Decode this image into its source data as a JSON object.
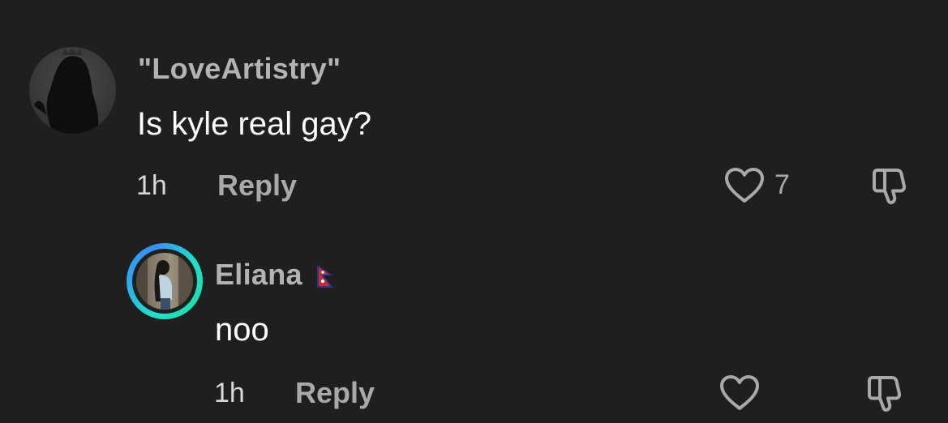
{
  "comments": [
    {
      "username": "\"LoveArtistry\"",
      "text": "Is kyle real gay?",
      "time": "1h",
      "reply_label": "Reply",
      "likes": "7"
    }
  ],
  "reply": {
    "username": "Eliana",
    "text": "noo",
    "time": "1h",
    "reply_label": "Reply"
  },
  "icons": {
    "like": "heart-outline-icon",
    "dislike": "thumbs-down-outline-icon",
    "flag": "nepal-flag-icon"
  },
  "colors": {
    "background": "#1f1f1f",
    "username": "#b3b3b3",
    "text": "#ffffff",
    "muted": "#a9a9a9",
    "ring_start": "#1fe0c8",
    "ring_end": "#3a8ff5"
  }
}
